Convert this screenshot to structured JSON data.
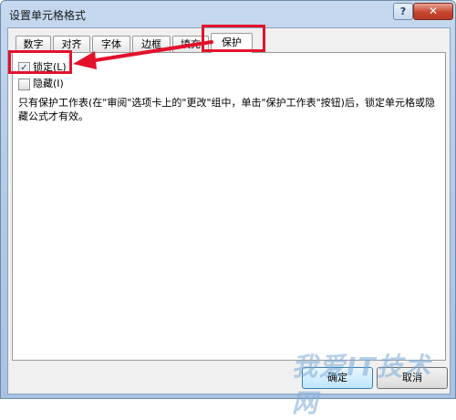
{
  "window": {
    "title": "设置单元格格式",
    "help_glyph": "?",
    "close_glyph": "✕"
  },
  "tabs": [
    {
      "label": "数字"
    },
    {
      "label": "对齐"
    },
    {
      "label": "字体"
    },
    {
      "label": "边框"
    },
    {
      "label": "填充"
    },
    {
      "label": "保护"
    }
  ],
  "active_tab": "保护",
  "protection": {
    "locked": {
      "label": "锁定(L)",
      "checked": true
    },
    "hidden": {
      "label": "隐藏(I)",
      "checked": false
    },
    "description": "只有保护工作表(在\"审阅\"选项卡上的\"更改\"组中，单击\"保护工作表\"按钮)后，锁定单元格或隐藏公式才有效。"
  },
  "buttons": {
    "ok": "确定",
    "cancel": "取消"
  },
  "watermark": "我爱IT技术网",
  "colors": {
    "highlight": "#e3122c",
    "accent": "#3c7fb1"
  }
}
